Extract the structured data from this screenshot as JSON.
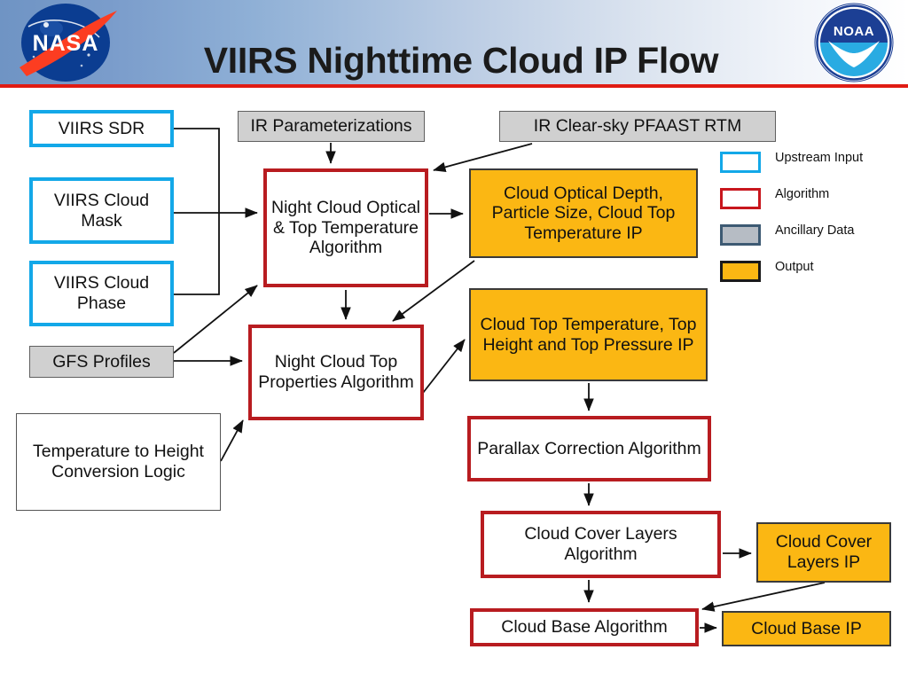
{
  "header": {
    "title": "VIIRS Nighttime Cloud IP Flow",
    "left_logo": "nasa-logo",
    "right_logo": "noaa-logo",
    "colors": {
      "rule": "#e01b13",
      "gradient_start": "#6f94c4",
      "gradient_end": "#ffffff"
    }
  },
  "legend": {
    "items": [
      {
        "label": "Upstream Input",
        "swatch": "upstream",
        "color": "#13a8e8"
      },
      {
        "label": "Algorithm",
        "swatch": "algorithm",
        "color": "#c8161d"
      },
      {
        "label": "Ancillary Data",
        "swatch": "ancillary",
        "color": "#b6bcc4"
      },
      {
        "label": "Output",
        "swatch": "output",
        "color": "#fbb713"
      }
    ]
  },
  "nodes": {
    "viirs_sdr": {
      "label": "VIIRS SDR",
      "type": "Upstream Input"
    },
    "viirs_cloud_mask": {
      "label": "VIIRS Cloud Mask",
      "type": "Upstream Input"
    },
    "viirs_cloud_phase": {
      "label": "VIIRS Cloud Phase",
      "type": "Upstream Input"
    },
    "gfs_profiles": {
      "label": "GFS Profiles",
      "type": "Ancillary Data"
    },
    "temp_to_height": {
      "label": "Temperature to Height Conversion Logic",
      "type": "Ancillary Data"
    },
    "ir_parameterizations": {
      "label": "IR  Parameterizations",
      "type": "Ancillary Data"
    },
    "ir_clear_sky_pfaast": {
      "label": "IR Clear-sky PFAAST RTM",
      "type": "Ancillary Data"
    },
    "night_cloud_optical": {
      "label": "Night Cloud Optical & Top Temperature Algorithm",
      "type": "Algorithm"
    },
    "night_cloud_top_props": {
      "label": "Night Cloud Top Properties Algorithm",
      "type": "Algorithm"
    },
    "cloud_optical_depth_ip": {
      "label": "Cloud Optical Depth, Particle Size, Cloud Top Temperature IP",
      "type": "Output"
    },
    "cloud_top_temp_ip": {
      "label": "Cloud Top Temperature, Top Height and Top Pressure IP",
      "type": "Output"
    },
    "parallax_correction": {
      "label": "Parallax Correction Algorithm",
      "type": "Algorithm"
    },
    "cloud_cover_layers_alg": {
      "label": "Cloud Cover Layers Algorithm",
      "type": "Algorithm"
    },
    "cloud_cover_layers_ip": {
      "label": "Cloud Cover Layers IP",
      "type": "Output"
    },
    "cloud_base_alg": {
      "label": "Cloud Base Algorithm",
      "type": "Algorithm"
    },
    "cloud_base_ip": {
      "label": "Cloud Base IP",
      "type": "Output"
    }
  },
  "edges": [
    {
      "from": "viirs_sdr",
      "to": "night_cloud_optical"
    },
    {
      "from": "viirs_cloud_mask",
      "to": "night_cloud_optical"
    },
    {
      "from": "viirs_cloud_phase",
      "to": "night_cloud_optical"
    },
    {
      "from": "ir_parameterizations",
      "to": "night_cloud_optical"
    },
    {
      "from": "ir_clear_sky_pfaast",
      "to": "night_cloud_optical"
    },
    {
      "from": "gfs_profiles",
      "to": "night_cloud_optical"
    },
    {
      "from": "gfs_profiles",
      "to": "night_cloud_top_props"
    },
    {
      "from": "temp_to_height",
      "to": "night_cloud_top_props"
    },
    {
      "from": "night_cloud_optical",
      "to": "cloud_optical_depth_ip"
    },
    {
      "from": "night_cloud_optical",
      "to": "night_cloud_top_props"
    },
    {
      "from": "cloud_optical_depth_ip",
      "to": "night_cloud_top_props"
    },
    {
      "from": "night_cloud_top_props",
      "to": "cloud_top_temp_ip"
    },
    {
      "from": "cloud_top_temp_ip",
      "to": "parallax_correction"
    },
    {
      "from": "parallax_correction",
      "to": "cloud_cover_layers_alg"
    },
    {
      "from": "cloud_cover_layers_alg",
      "to": "cloud_cover_layers_ip"
    },
    {
      "from": "cloud_cover_layers_alg",
      "to": "cloud_base_alg"
    },
    {
      "from": "cloud_cover_layers_ip",
      "to": "cloud_base_alg"
    },
    {
      "from": "cloud_base_alg",
      "to": "cloud_base_ip"
    }
  ]
}
